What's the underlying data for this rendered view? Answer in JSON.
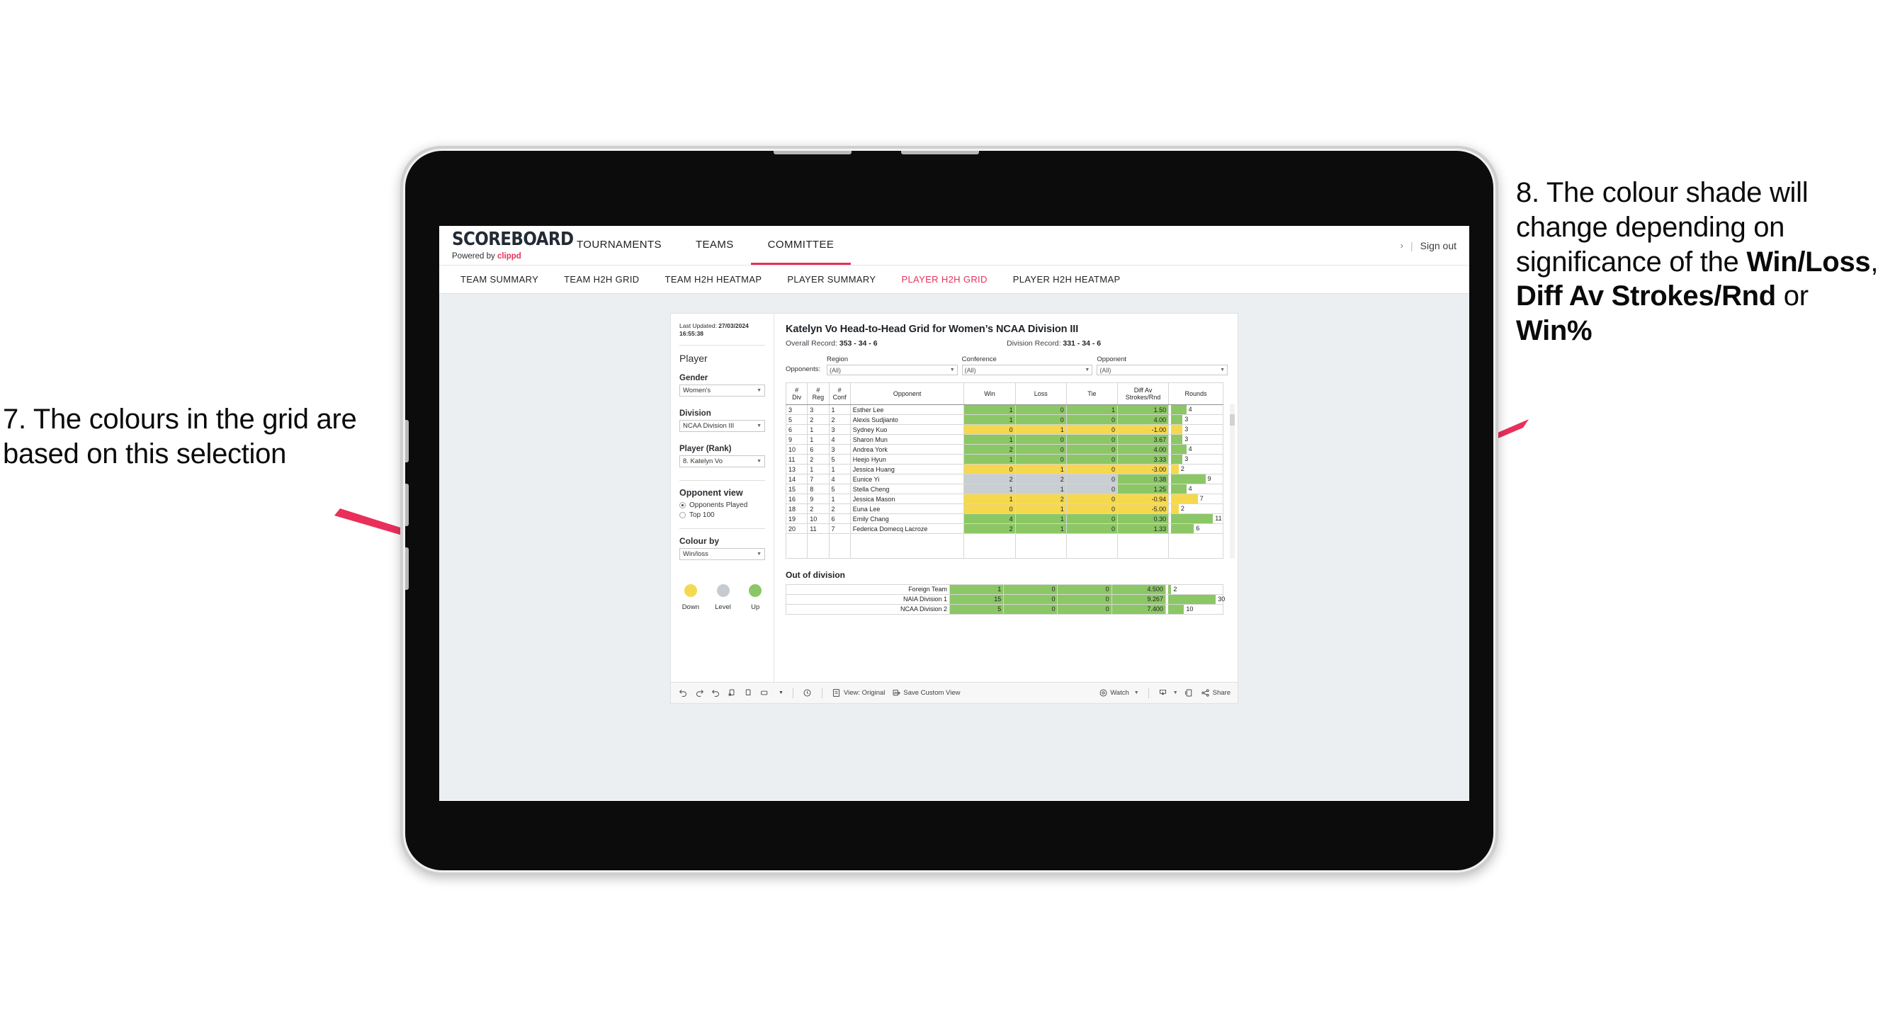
{
  "annotations": {
    "left": {
      "name": "annotation-7",
      "text": "7. The colours in the grid are based on this selection"
    },
    "right": {
      "name": "annotation-8",
      "prefix": "8. The colour shade will change depending on significance of the ",
      "bold1": "Win/Loss",
      "mid1": ", ",
      "bold2": "Diff Av Strokes/Rnd",
      "mid2": " or ",
      "bold3": "Win%"
    },
    "arrow_color": "#e8305a"
  },
  "header": {
    "logo_main": "SCOREBOARD",
    "logo_sub_prefix": "Powered by ",
    "logo_sub_brand": "clippd",
    "nav": [
      {
        "label": "TOURNAMENTS",
        "active": false
      },
      {
        "label": "TEAMS",
        "active": false
      },
      {
        "label": "COMMITTEE",
        "active": true
      }
    ],
    "chevron": "›",
    "separator": "|",
    "sign_out": "Sign out",
    "accent_color": "#e8305a"
  },
  "subnav": [
    {
      "label": "TEAM SUMMARY",
      "active": false
    },
    {
      "label": "TEAM H2H GRID",
      "active": false
    },
    {
      "label": "TEAM H2H HEATMAP",
      "active": false
    },
    {
      "label": "PLAYER SUMMARY",
      "active": false
    },
    {
      "label": "PLAYER H2H GRID",
      "active": true
    },
    {
      "label": "PLAYER H2H HEATMAP",
      "active": false
    }
  ],
  "sidebar": {
    "last_updated_label": "Last Updated: ",
    "last_updated_value": "27/03/2024 16:55:38",
    "player_heading": "Player",
    "gender_label": "Gender",
    "gender_value": "Women's",
    "division_label": "Division",
    "division_value": "NCAA Division III",
    "player_rank_label": "Player (Rank)",
    "player_rank_value": "8. Katelyn Vo",
    "opponent_view_heading": "Opponent view",
    "opponent_view_options": [
      {
        "label": "Opponents Played",
        "selected": true
      },
      {
        "label": "Top 100",
        "selected": false
      }
    ],
    "colour_by_label": "Colour by",
    "colour_by_value": "Win/loss",
    "legend": [
      {
        "label": "Down",
        "color": "#f5d84e"
      },
      {
        "label": "Level",
        "color": "#c6cbd0"
      },
      {
        "label": "Up",
        "color": "#8cc765"
      }
    ]
  },
  "main": {
    "title": "Katelyn Vo Head-to-Head Grid for Women’s NCAA Division III",
    "overall_record_label": "Overall Record: ",
    "overall_record_value": "353 -  34 - 6",
    "division_record_label": "Division Record: ",
    "division_record_value": "331 -  34 - 6",
    "opponents_label": "Opponents:",
    "filters": [
      {
        "label": "Region",
        "value": "(All)"
      },
      {
        "label": "Conference",
        "value": "(All)"
      },
      {
        "label": "Opponent",
        "value": "(All)"
      }
    ],
    "columns": [
      "# Div",
      "# Reg",
      "# Conf",
      "Opponent",
      "Win",
      "Loss",
      "Tie",
      "Diff Av Strokes/Rnd",
      "Rounds"
    ],
    "column_lines": [
      [
        "#",
        "Div"
      ],
      [
        "#",
        "Reg"
      ],
      [
        "#",
        "Conf"
      ],
      [
        "Opponent",
        ""
      ],
      [
        "Win",
        ""
      ],
      [
        "Loss",
        ""
      ],
      [
        "Tie",
        ""
      ],
      [
        "Diff Av",
        "Strokes/Rnd"
      ],
      [
        "Rounds",
        ""
      ]
    ],
    "out_of_division_title": "Out of division"
  },
  "chart_data": {
    "type": "table",
    "title": "Katelyn Vo Head-to-Head Grid for Women’s NCAA Division III",
    "colour_by": "Win/loss",
    "colors": {
      "up": "#8cc765",
      "down": "#f5d84e",
      "level": "#c9ced2"
    },
    "columns": [
      "#Div",
      "#Reg",
      "#Conf",
      "Opponent",
      "Win",
      "Loss",
      "Tie",
      "Diff Av Strokes/Rnd",
      "Rounds"
    ],
    "rounds_axis_max": 13,
    "rows": [
      {
        "div": "3",
        "reg": "3",
        "conf": "1",
        "opponent": "Esther Lee",
        "win": "1",
        "loss": "0",
        "tie": "1",
        "diff": "1.50",
        "rounds": "4",
        "shade": "up"
      },
      {
        "div": "5",
        "reg": "2",
        "conf": "2",
        "opponent": "Alexis Sudjianto",
        "win": "1",
        "loss": "0",
        "tie": "0",
        "diff": "4.00",
        "rounds": "3",
        "shade": "up"
      },
      {
        "div": "6",
        "reg": "1",
        "conf": "3",
        "opponent": "Sydney Kuo",
        "win": "0",
        "loss": "1",
        "tie": "0",
        "diff": "-1.00",
        "rounds": "3",
        "shade": "down"
      },
      {
        "div": "9",
        "reg": "1",
        "conf": "4",
        "opponent": "Sharon Mun",
        "win": "1",
        "loss": "0",
        "tie": "0",
        "diff": "3.67",
        "rounds": "3",
        "shade": "up"
      },
      {
        "div": "10",
        "reg": "6",
        "conf": "3",
        "opponent": "Andrea York",
        "win": "2",
        "loss": "0",
        "tie": "0",
        "diff": "4.00",
        "rounds": "4",
        "shade": "up"
      },
      {
        "div": "11",
        "reg": "2",
        "conf": "5",
        "opponent": "Heejo Hyun",
        "win": "1",
        "loss": "0",
        "tie": "0",
        "diff": "3.33",
        "rounds": "3",
        "shade": "up"
      },
      {
        "div": "13",
        "reg": "1",
        "conf": "1",
        "opponent": "Jessica Huang",
        "win": "0",
        "loss": "1",
        "tie": "0",
        "diff": "-3.00",
        "rounds": "2",
        "shade": "down"
      },
      {
        "div": "14",
        "reg": "7",
        "conf": "4",
        "opponent": "Eunice Yi",
        "win": "2",
        "loss": "2",
        "tie": "0",
        "diff": "0.38",
        "rounds": "9",
        "shade": "level",
        "diff_shade": "up"
      },
      {
        "div": "15",
        "reg": "8",
        "conf": "5",
        "opponent": "Stella Cheng",
        "win": "1",
        "loss": "1",
        "tie": "0",
        "diff": "1.25",
        "rounds": "4",
        "shade": "level",
        "diff_shade": "up"
      },
      {
        "div": "16",
        "reg": "9",
        "conf": "1",
        "opponent": "Jessica Mason",
        "win": "1",
        "loss": "2",
        "tie": "0",
        "diff": "-0.94",
        "rounds": "7",
        "shade": "down"
      },
      {
        "div": "18",
        "reg": "2",
        "conf": "2",
        "opponent": "Euna Lee",
        "win": "0",
        "loss": "1",
        "tie": "0",
        "diff": "-5.00",
        "rounds": "2",
        "shade": "down"
      },
      {
        "div": "19",
        "reg": "10",
        "conf": "6",
        "opponent": "Emily Chang",
        "win": "4",
        "loss": "1",
        "tie": "0",
        "diff": "0.30",
        "rounds": "11",
        "shade": "up"
      },
      {
        "div": "20",
        "reg": "11",
        "conf": "7",
        "opponent": "Federica Domecq Lacroze",
        "win": "2",
        "loss": "1",
        "tie": "0",
        "diff": "1.33",
        "rounds": "6",
        "shade": "up"
      }
    ],
    "out_of_division": [
      {
        "name": "Foreign Team",
        "win": "1",
        "loss": "0",
        "tie": "0",
        "diff": "4.500",
        "rounds": "2",
        "shade": "up"
      },
      {
        "name": "NAIA Division 1",
        "win": "15",
        "loss": "0",
        "tie": "0",
        "diff": "9.267",
        "rounds": "30",
        "shade": "up"
      },
      {
        "name": "NCAA Division 2",
        "win": "5",
        "loss": "0",
        "tie": "0",
        "diff": "7.400",
        "rounds": "10",
        "shade": "up"
      }
    ],
    "out_of_division_rounds_max": 33
  },
  "toolbar": {
    "items": [
      {
        "name": "undo-icon",
        "label": ""
      },
      {
        "name": "redo-icon",
        "label": ""
      },
      {
        "name": "revert-icon",
        "label": ""
      },
      {
        "name": "refresh-icon",
        "label": ""
      },
      {
        "name": "pause-icon",
        "label": ""
      },
      {
        "name": "layout-icon",
        "label": ""
      },
      {
        "name": "chevron-down-icon",
        "label": ""
      },
      {
        "name": "clock-icon",
        "label": ""
      },
      {
        "name": "view-icon",
        "label": "View: Original"
      },
      {
        "name": "save-custom-view-icon",
        "label": "Save Custom View"
      },
      {
        "name": "watch-icon",
        "label": "Watch"
      },
      {
        "name": "download-icon",
        "label": ""
      },
      {
        "name": "fullscreen-icon",
        "label": ""
      },
      {
        "name": "share-icon",
        "label": "Share"
      }
    ],
    "view_label": "View: Original",
    "save_custom_view_label": "Save Custom View",
    "watch_label": "Watch",
    "share_label": "Share"
  }
}
